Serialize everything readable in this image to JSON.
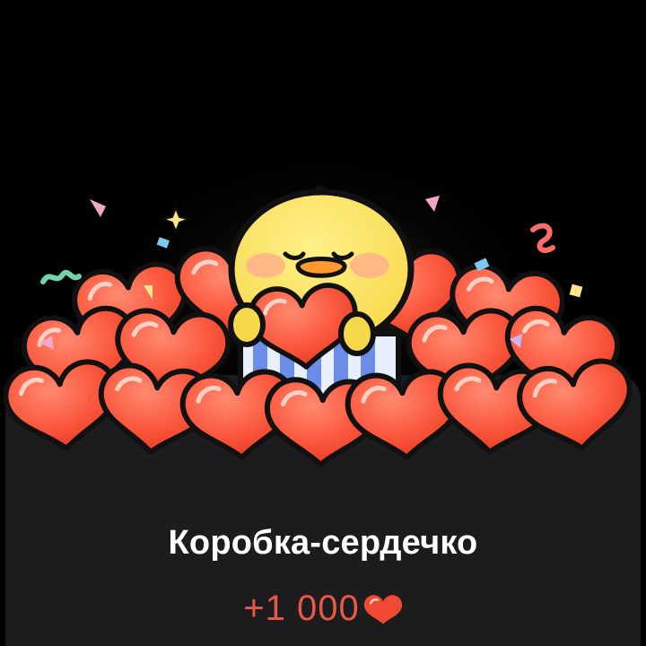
{
  "gift": {
    "title": "Коробка-сердечко",
    "price": "+1 000"
  },
  "colors": {
    "background": "#000000",
    "card": "#1c1c1e",
    "title": "#ffffff",
    "price": "#e8584a",
    "heart": "#f04a35"
  },
  "icons": {
    "price_icon": "heart-icon",
    "illustration": "duck-with-hearts-sticker"
  }
}
